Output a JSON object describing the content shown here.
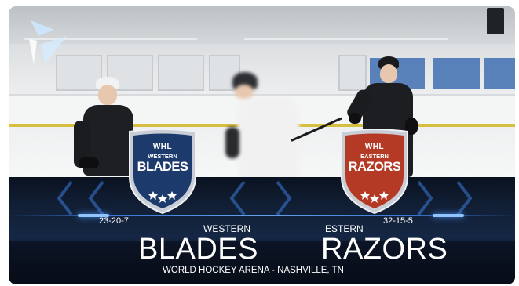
{
  "broadcast": {
    "home": {
      "league": "WHL",
      "badge_top": "WESTERN",
      "badge_name": "BLADES",
      "conference": "WESTERN",
      "name": "BLADES",
      "record": "23-20-7",
      "color": "#1c3a6b"
    },
    "away": {
      "league": "WHL",
      "badge_top": "EASTERN",
      "badge_name": "RAZORS",
      "conference": "ESTERN",
      "name": "RAZORS",
      "record": "32-15-5",
      "color": "#b43a26"
    },
    "venue": "WORLD HOCKEY ARENA - NASHVILLE, TN",
    "accent": "#4d95ff",
    "logo_icon": "play-logo-icon"
  }
}
